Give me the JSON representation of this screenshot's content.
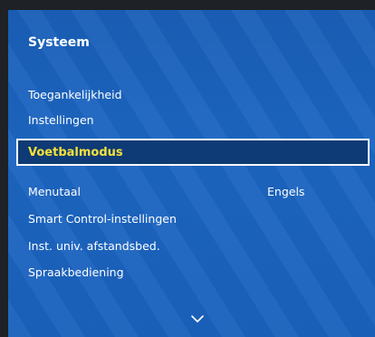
{
  "menu": {
    "title": "Systeem",
    "items": [
      {
        "label": "Toegankelijkheid"
      },
      {
        "label": "Instellingen"
      },
      {
        "label": "Voetbalmodus",
        "selected": true
      },
      {
        "label": "Menutaal",
        "value": "Engels"
      },
      {
        "label": "Smart Control-instellingen"
      },
      {
        "label": "Inst. univ. afstandsbed."
      },
      {
        "label": "Spraakbediening"
      }
    ],
    "scroll_indicator": "chevron-down-icon"
  },
  "colors": {
    "panel": "#1c66c2",
    "highlight_bg": "#0e3b75",
    "highlight_text": "#f5e13a",
    "text": "#ffffff"
  }
}
